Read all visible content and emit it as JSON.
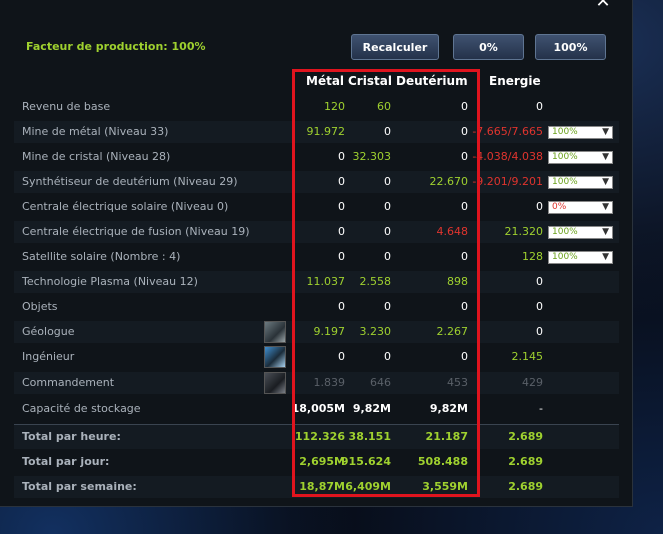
{
  "header": {
    "factor_label": "Facteur de production: 100%",
    "recalc_label": "Recalculer",
    "zero_label": "0%",
    "hundred_label": "100%",
    "close_label": "✕"
  },
  "columns": {
    "metal": "Métal",
    "crystal": "Cristal",
    "deuterium": "Deutérium",
    "energy": "Energie"
  },
  "rows": [
    {
      "label": "Revenu de base",
      "metal": "120",
      "crystal": "60",
      "deuterium": "0",
      "energy": "0"
    },
    {
      "label": "Mine de métal (Niveau 33)",
      "metal": "91.972",
      "crystal": "0",
      "deuterium": "0",
      "energy": "-7.665/7.665",
      "select": "100%"
    },
    {
      "label": "Mine de cristal (Niveau 28)",
      "metal": "0",
      "crystal": "32.303",
      "deuterium": "0",
      "energy": "-4.038/4.038",
      "select": "100%"
    },
    {
      "label": "Synthétiseur de deutérium (Niveau 29)",
      "metal": "0",
      "crystal": "0",
      "deuterium": "22.670",
      "energy": "-9.201/9.201",
      "select": "100%"
    },
    {
      "label": "Centrale électrique solaire (Niveau 0)",
      "metal": "0",
      "crystal": "0",
      "deuterium": "0",
      "energy": "0",
      "select": "0%"
    },
    {
      "label": "Centrale électrique de fusion (Niveau 19)",
      "metal": "0",
      "crystal": "0",
      "deuterium": "4.648",
      "energy": "21.320",
      "select": "100%"
    },
    {
      "label": "Satellite solaire (Nombre : 4)",
      "metal": "0",
      "crystal": "0",
      "deuterium": "0",
      "energy": "128",
      "select": "100%"
    },
    {
      "label": "Technologie Plasma (Niveau 12)",
      "metal": "11.037",
      "crystal": "2.558",
      "deuterium": "898",
      "energy": "0"
    },
    {
      "label": "Objets",
      "metal": "0",
      "crystal": "0",
      "deuterium": "0",
      "energy": "0"
    },
    {
      "label": "Géologue",
      "metal": "9.197",
      "crystal": "3.230",
      "deuterium": "2.267",
      "energy": "0",
      "icon": "geologist-portrait"
    },
    {
      "label": "Ingénieur",
      "metal": "0",
      "crystal": "0",
      "deuterium": "0",
      "energy": "2.145",
      "icon": "engineer-portrait"
    },
    {
      "label": "Commandement",
      "metal": "1.839",
      "crystal": "646",
      "deuterium": "453",
      "energy": "429",
      "icon": "commander-portrait"
    },
    {
      "label": "Capacité de stockage",
      "metal": "18,005M",
      "crystal": "9,82M",
      "deuterium": "9,82M",
      "energy": "-"
    },
    {
      "label": "Total par heure:",
      "metal": "112.326",
      "crystal": "38.151",
      "deuterium": "21.187",
      "energy": "2.689"
    },
    {
      "label": "Total par jour:",
      "metal": "2,695M",
      "crystal": "915.624",
      "deuterium": "508.488",
      "energy": "2.689"
    },
    {
      "label": "Total par semaine:",
      "metal": "18,87M",
      "crystal": "6,409M",
      "deuterium": "3,559M",
      "energy": "2.689"
    }
  ],
  "colors": {
    "green": "#9fd12f",
    "red": "#e0342e",
    "highlight": "#e0141e",
    "panel": "#0f1419"
  }
}
